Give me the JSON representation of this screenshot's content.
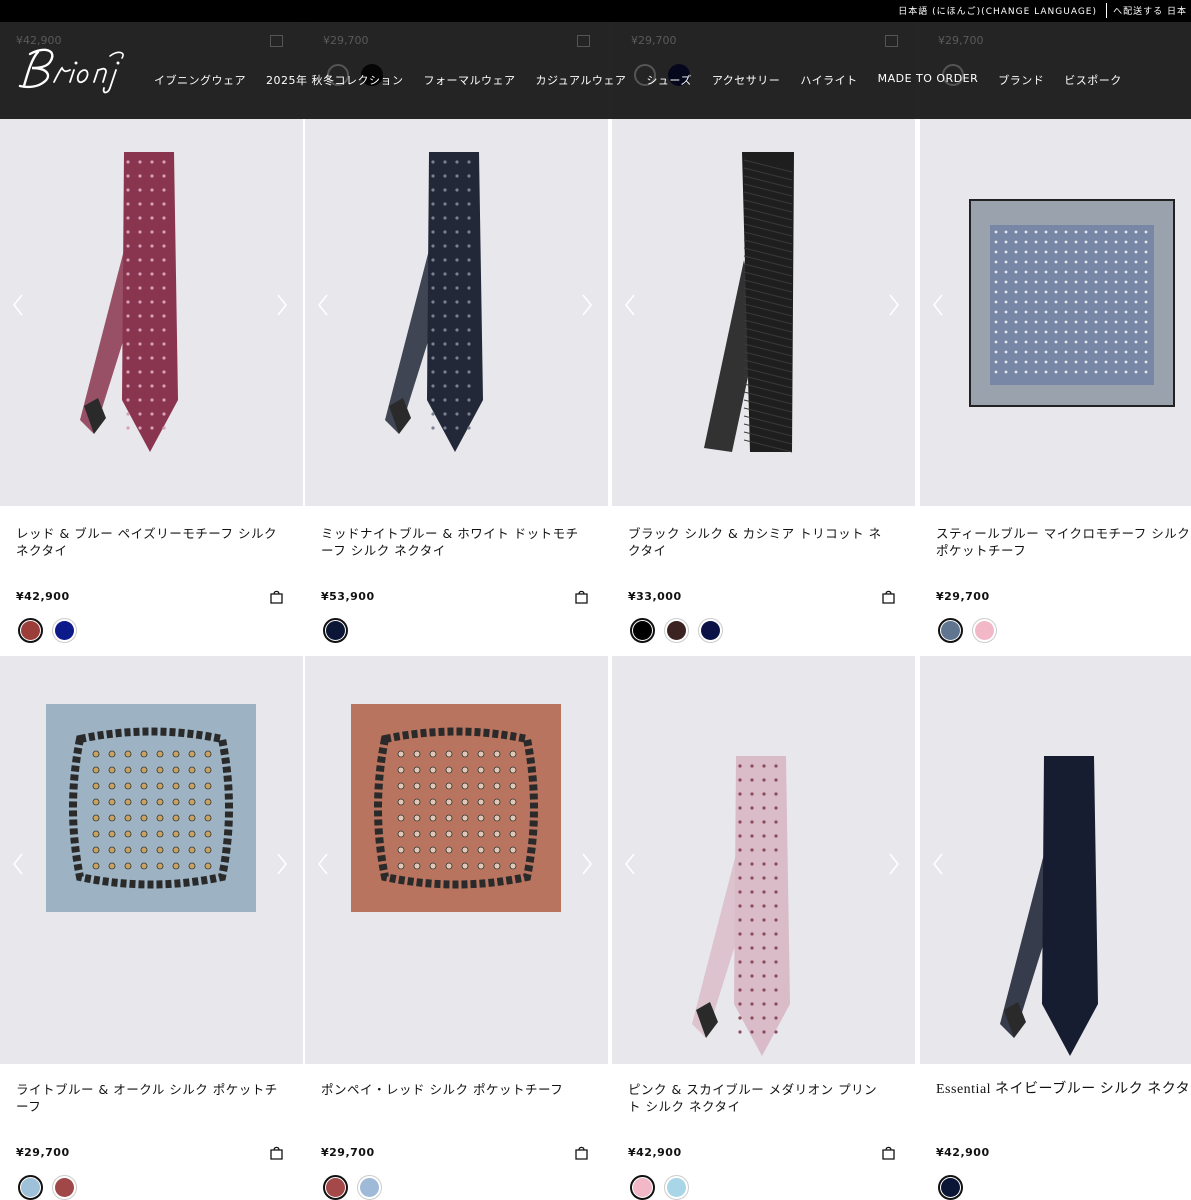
{
  "topbar": {
    "language": "日本語 (にほんご)(CHANGE LANGUAGE)",
    "shipping": "へ配送する 日本"
  },
  "header": {
    "logo_text": "Brioni",
    "nav": [
      "イブニングウェア",
      "2025年 秋冬コレクション",
      "フォーマルウェア",
      "カジュアルウェア",
      "シューズ",
      "アクセサリー",
      "ハイライト",
      "MADE TO ORDER",
      "ブランド",
      "ビスポーク"
    ],
    "ghost_prices": [
      "¥42,900",
      "¥29,700",
      "¥29,700",
      "¥29,700"
    ]
  },
  "products": [
    {
      "name": "レッド & ブルー ペイズリーモチーフ シルク ネクタイ",
      "price": "¥42,900",
      "type": "tie",
      "art_color": "#8a3550",
      "art_pattern": "#d8a0b8",
      "swatches": [
        "#9b3e3a",
        "#0d1a8a"
      ],
      "selected": 0
    },
    {
      "name": "ミッドナイトブルー & ホワイト ドットモチーフ シルク ネクタイ",
      "price": "¥53,900",
      "type": "tie",
      "art_color": "#222838",
      "art_pattern": "#7a8090",
      "swatches": [
        "#0b1535"
      ],
      "selected": 0
    },
    {
      "name": "ブラック シルク & カシミア トリコット ネクタイ",
      "price": "¥33,000",
      "type": "knit",
      "art_color": "#1e1e1e",
      "art_pattern": "#3a3a3a",
      "swatches": [
        "#000000",
        "#3a2320",
        "#0b1245"
      ],
      "selected": 0
    },
    {
      "name": "スティールブルー マイクロモチーフ シルク ポケットチーフ",
      "price": "¥29,700",
      "type": "square",
      "art_color": "#9aa3ad",
      "art_pattern": "#6f7fa4",
      "swatches": [
        "#5f7590",
        "#f2b8c8"
      ],
      "selected": 0
    },
    {
      "name": "ライトブルー & オークル シルク ポケットチーフ",
      "price": "¥29,700",
      "type": "paisley",
      "art_color": "#9db3c3",
      "art_pattern": "#c9a460",
      "swatches": [
        "#9ec0d8",
        "#a04848"
      ],
      "selected": 0
    },
    {
      "name": "ポンペイ・レッド シルク ポケットチーフ",
      "price": "¥29,700",
      "type": "paisley",
      "art_color": "#b8745f",
      "art_pattern": "#e0c9b8",
      "swatches": [
        "#a44848",
        "#9ebad8"
      ],
      "selected": 0
    },
    {
      "name": "ピンク & スカイブルー メダリオン プリント シルク ネクタイ",
      "price": "¥42,900",
      "type": "tie",
      "art_color": "#d9bcc8",
      "art_pattern": "#8a4a5a",
      "swatches": [
        "#f2b8c8",
        "#a8d6e6"
      ],
      "selected": 0
    },
    {
      "name": "Essential ネイビーブルー シルク ネクタイ",
      "price": "¥42,900",
      "type": "tie",
      "art_color": "#161d30",
      "art_pattern": "#161d30",
      "swatches": [
        "#0b1535"
      ],
      "selected": 0,
      "serif": true
    }
  ]
}
